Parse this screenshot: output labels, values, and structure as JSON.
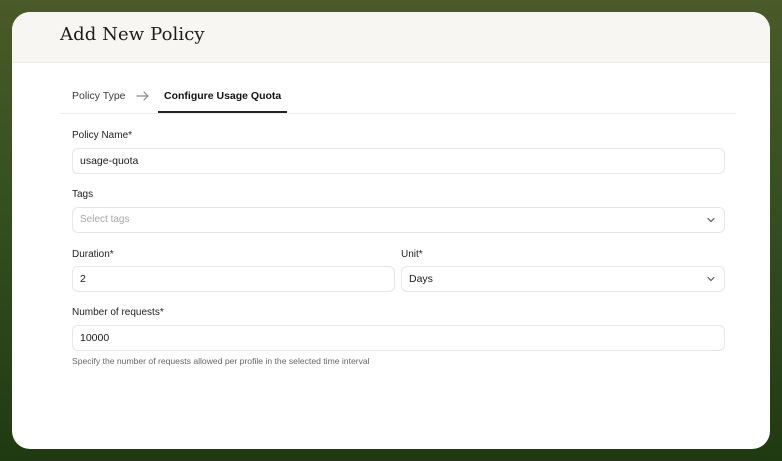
{
  "header": {
    "title": "Add New Policy"
  },
  "stepper": {
    "steps": [
      {
        "label": "Policy Type",
        "active": false
      },
      {
        "label": "Configure Usage Quota",
        "active": true
      }
    ]
  },
  "form": {
    "policy_name": {
      "label": "Policy Name*",
      "value": "usage-quota"
    },
    "tags": {
      "label": "Tags",
      "placeholder": "Select tags"
    },
    "duration": {
      "label": "Duration*",
      "value": "2"
    },
    "unit": {
      "label": "Unit*",
      "value": "Days"
    },
    "requests": {
      "label": "Number of requests*",
      "value": "10000",
      "helper": "Specify the number of requests allowed per profile in the selected time interval"
    }
  },
  "colors": {
    "frame_top": "#4a5a28",
    "frame_bottom": "#1f3a12",
    "header_bg": "#f7f6f3",
    "active_step": "#222222"
  },
  "icons": {
    "step_separator": "arrow-right-icon",
    "dropdown": "chevron-down-icon"
  }
}
